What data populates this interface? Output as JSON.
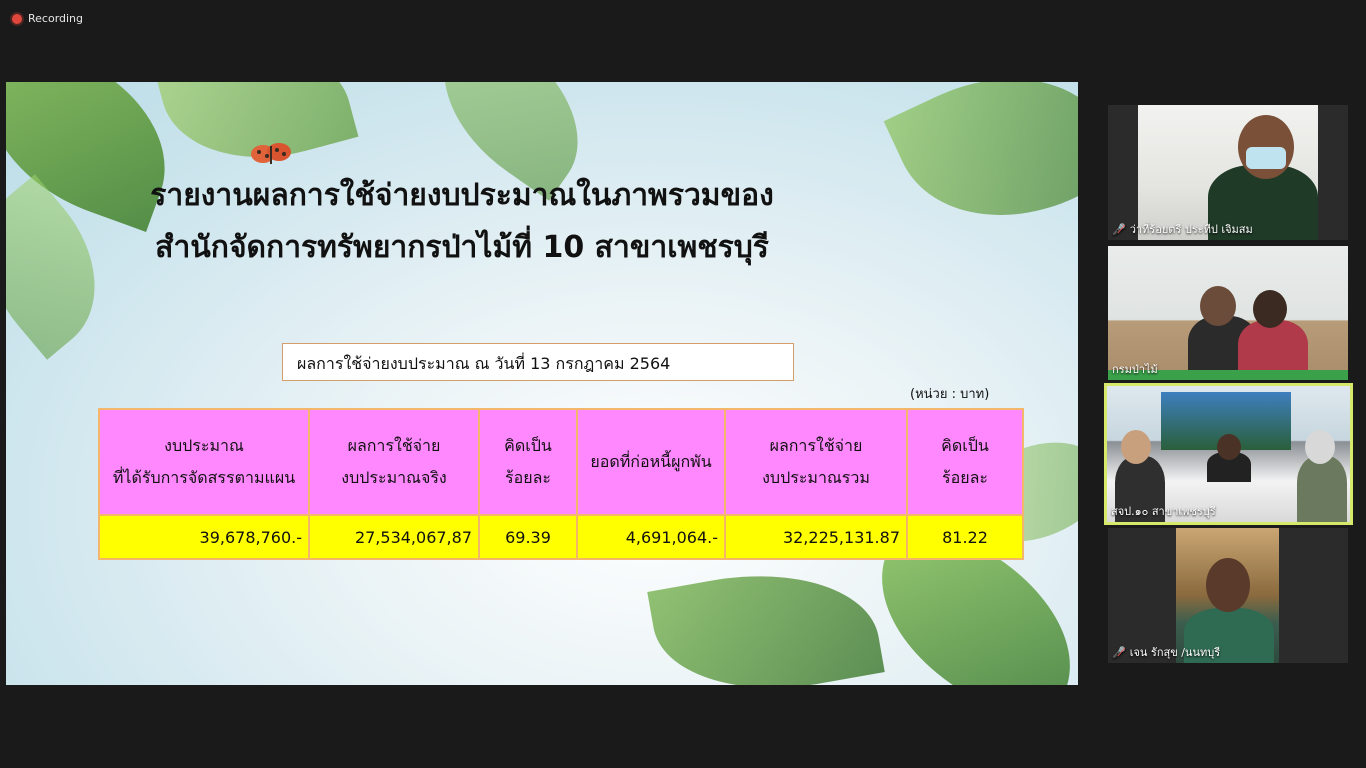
{
  "recording": {
    "label": "Recording"
  },
  "slide": {
    "title_line1": "รายงานผลการใช้จ่ายงบประมาณในภาพรวมของ",
    "title_line2": "สำนักจัดการทรัพยากรป่าไม้ที่ 10 สาขาเพชรบุรี",
    "date_box": "ผลการใช้จ่ายงบประมาณ ณ วันที่  13 กรกฎาคม 2564",
    "unit": "(หน่วย : บาท)",
    "table": {
      "headers": [
        {
          "line1": "งบประมาณ",
          "line2": "ที่ได้รับการจัดสรรตามแผน"
        },
        {
          "line1": "ผลการใช้จ่าย",
          "line2": "งบประมาณจริง"
        },
        {
          "line1": "คิดเป็น",
          "line2": "ร้อยละ"
        },
        {
          "line1": "ยอดที่ก่อหนี้ผูกพัน",
          "line2": ""
        },
        {
          "line1": "ผลการใช้จ่าย",
          "line2": "งบประมาณรวม"
        },
        {
          "line1": "คิดเป็น",
          "line2": "ร้อยละ"
        }
      ],
      "row": [
        "39,678,760.-",
        "27,534,067,87",
        "69.39",
        "4,691,064.-",
        "32,225,131.87",
        "81.22"
      ]
    }
  },
  "participants": [
    {
      "name": "ว่าที่ร้อยตรี ประทีป เจิมสม",
      "muted": true
    },
    {
      "name": "กรมป่าไม้",
      "muted": false
    },
    {
      "name": "สจป.๑๐ สาขาเพชรบุรี",
      "muted": false,
      "active": true
    },
    {
      "name": "เจน รักสุข /นนทบุรี",
      "muted": true
    }
  ],
  "icons": {
    "mic_off": "mic-off-icon",
    "recording": "recording-dot-icon"
  }
}
